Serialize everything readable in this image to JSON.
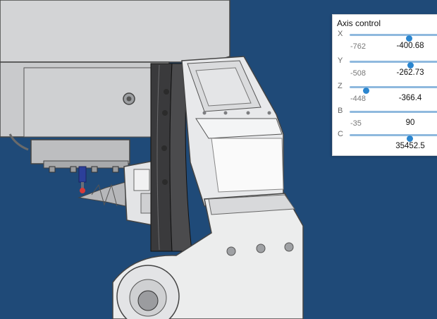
{
  "panel": {
    "title": "Axis control",
    "axes": [
      {
        "label": "X",
        "min": "-762",
        "value": "-400.68",
        "position": 0.67
      },
      {
        "label": "Y",
        "min": "-508",
        "value": "-262.73",
        "position": 0.69
      },
      {
        "label": "Z",
        "min": "-448",
        "value": "-366.4",
        "position": 0.18
      },
      {
        "label": "B",
        "min": "-35",
        "value": "90",
        "position": null
      },
      {
        "label": "C",
        "min": "",
        "value": "35452.5",
        "position": 0.68
      }
    ]
  },
  "colors": {
    "background": "#1f4a78",
    "model": "#d6d7d9",
    "slider_thumb": "#2b86cf",
    "slider_track": "#8fb9de"
  }
}
